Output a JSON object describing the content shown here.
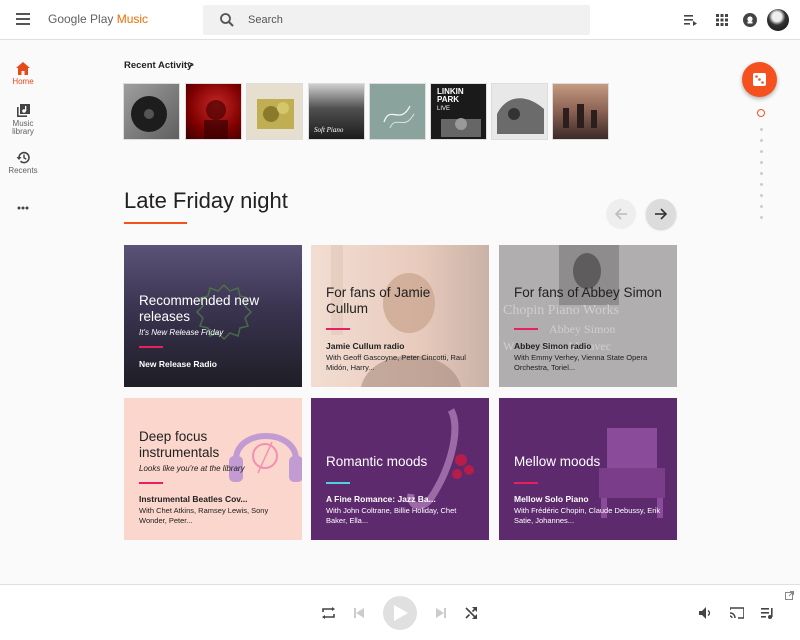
{
  "app": {
    "logo_main": "Google Play ",
    "logo_accent": "Music"
  },
  "search": {
    "placeholder": "Search"
  },
  "sidebar": {
    "items": [
      {
        "label": "Home",
        "icon": "home-icon",
        "active": true
      },
      {
        "label": "Music library",
        "icon": "music-library-icon"
      },
      {
        "label": "Recents",
        "icon": "history-icon"
      }
    ],
    "more_icon": "more-horiz-icon"
  },
  "recent": {
    "title": "Recent Activity",
    "chevron": ">"
  },
  "section": {
    "title": "Late Friday night"
  },
  "cards": [
    {
      "title": "Recommended new releases",
      "subtitle": "It's New Release Friday",
      "name": "New Release Radio",
      "desc": ""
    },
    {
      "title": "For fans of Jamie Cullum",
      "subtitle": "",
      "name": "Jamie Cullum radio",
      "desc": "With Geoff Gascoyne, Peter Cincotti, Raul Midón, Harry..."
    },
    {
      "title": "For fans of Abbey Simon",
      "subtitle": "",
      "name": "Abbey Simon radio",
      "desc": "With Emmy Verhey, Vienna State Opera Orchestra, Toriel..."
    },
    {
      "title": "Deep focus instrumentals",
      "subtitle": "Looks like you're at the library",
      "name": "Instrumental Beatles Cov...",
      "desc": "With Chet Atkins, Ramsey Lewis, Sony Wonder, Peter..."
    },
    {
      "title": "Romantic moods",
      "subtitle": "",
      "name": "A Fine Romance: Jazz Ba...",
      "desc": "With John Coltrane, Billie Holiday, Chet Baker, Ella..."
    },
    {
      "title": "Mellow moods",
      "subtitle": "",
      "name": "Mellow Solo Piano",
      "desc": "With Frédéric Chopin, Claude Debussy, Erik Satie, Johannes..."
    }
  ],
  "card_art": {
    "abbey_line1": "Chopin Piano Works",
    "abbey_line2": "Abbey Simon",
    "abbey_line3": "W          Ivan Moravec",
    "album2_text": "LINKIN PARK",
    "album2_sub": "LIVE",
    "album4_text": "Soft Piano"
  },
  "colors": {
    "accent": "#f4511e",
    "purple": "#5e2a6e",
    "peach": "#fbd6cc"
  }
}
